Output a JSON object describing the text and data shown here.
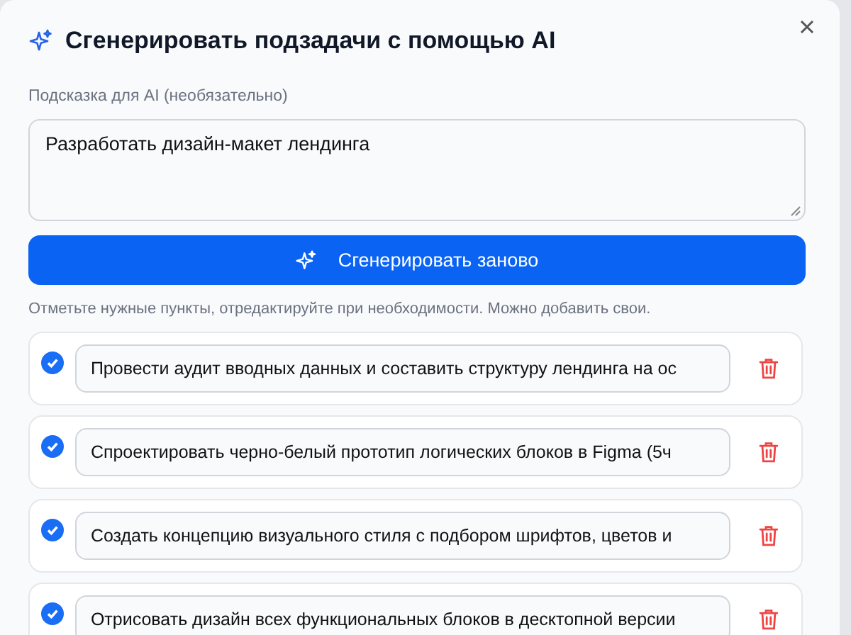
{
  "dialog": {
    "title": "Сгенерировать подзадачи с помощью AI"
  },
  "prompt": {
    "label": "Подсказка для AI (необязательно)",
    "value": "Разработать дизайн-макет лендинга"
  },
  "regenerate_button": "Сгенерировать заново",
  "hint": "Отметьте нужные пункты, отредактируйте при необходимости. Можно добавить свои.",
  "subtasks": [
    {
      "checked": true,
      "text": "Провести аудит вводных данных и составить структуру лендинга на ос"
    },
    {
      "checked": true,
      "text": "Спроектировать черно-белый прототип логических блоков в Figma (5ч"
    },
    {
      "checked": true,
      "text": "Создать концепцию визуального стиля с подбором шрифтов, цветов и"
    },
    {
      "checked": true,
      "text": "Отрисовать дизайн всех функциональных блоков в десктопной версии"
    }
  ]
}
